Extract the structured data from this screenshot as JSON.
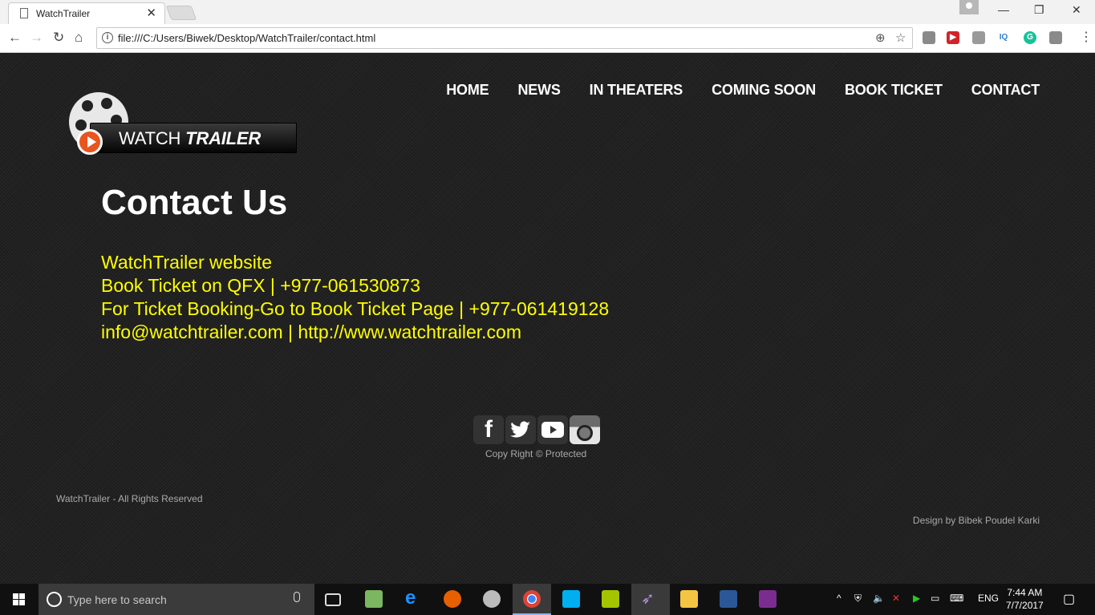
{
  "browser": {
    "tab_title": "WatchTrailer",
    "tab_close": "✕",
    "url": "file:///C:/Users/Biwek/Desktop/WatchTrailer/contact.html",
    "ext_iq_label": "IQ",
    "ext_g_label": "G"
  },
  "site": {
    "nav": [
      "HOME",
      "NEWS",
      "IN THEATERS",
      "COMING SOON",
      "BOOK TICKET",
      "CONTACT"
    ],
    "logo_text_main": "WATCH",
    "logo_text_bold": "TRAILER",
    "contact_title": "Contact Us",
    "contact_lines": [
      "WatchTrailer website",
      "Book Ticket on QFX | +977-061530873",
      "For Ticket Booking-Go to Book Ticket Page | +977-061419128",
      "info@watchtrailer.com | http://www.watchtrailer.com"
    ],
    "copyright": "Copy Right © Protected",
    "rights": "WatchTrailer - All Rights Reserved",
    "design_credit": "Design by Bibek Poudel Karki"
  },
  "taskbar": {
    "search_placeholder": "Type here to search",
    "language": "ENG",
    "time": "7:44 AM",
    "date": "7/7/2017"
  },
  "colors": {
    "accent_text": "#ffff00",
    "page_bg": "#222222"
  }
}
